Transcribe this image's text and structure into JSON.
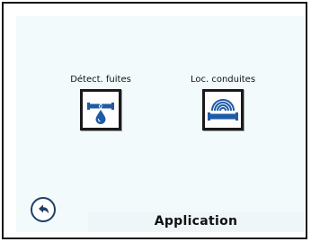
{
  "apps": [
    {
      "label": "Détect. fuites",
      "icon": "leak-detection-icon"
    },
    {
      "label": "Loc. conduites",
      "icon": "pipe-locator-icon"
    }
  ],
  "footer": {
    "title": "Application",
    "back_icon": "back-arrow-icon"
  },
  "colors": {
    "accent": "#1f5aa6",
    "screen": "#f2fafc",
    "frame": "#151515"
  }
}
